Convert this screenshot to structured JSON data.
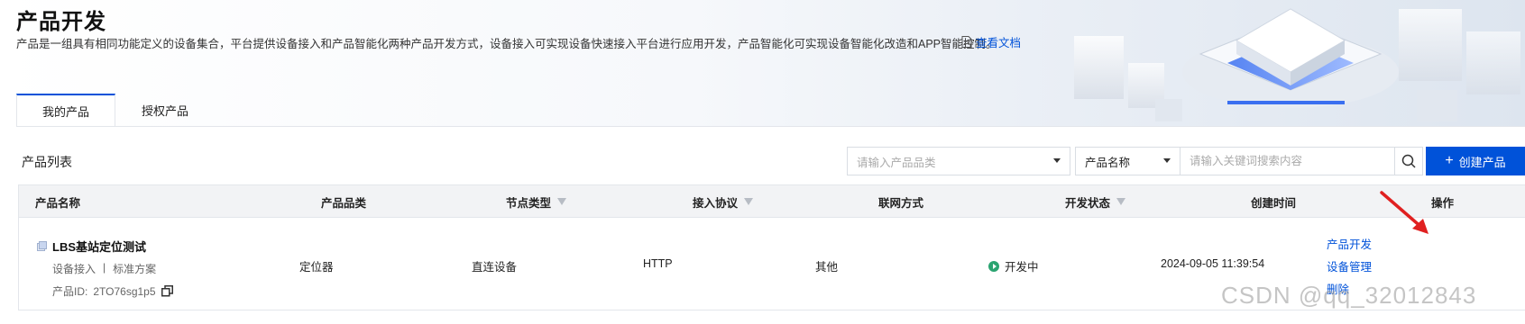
{
  "header": {
    "title": "产品开发",
    "description": "产品是一组具有相同功能定义的设备集合，平台提供设备接入和产品智能化两种产品开发方式，设备接入可实现设备快速接入平台进行应用开发，产品智能化可实现设备智能化改造和APP智能控制。",
    "doc_link": "查看文档"
  },
  "tabs": [
    {
      "label": "我的产品",
      "active": true
    },
    {
      "label": "授权产品",
      "active": false
    }
  ],
  "list": {
    "title": "产品列表",
    "category_select_placeholder": "请输入产品品类",
    "field_select_value": "产品名称",
    "search_placeholder": "请输入关键词搜索内容",
    "create_button": "创建产品"
  },
  "table": {
    "columns": [
      "产品名称",
      "产品品类",
      "节点类型",
      "接入协议",
      "联网方式",
      "开发状态",
      "创建时间",
      "操作"
    ],
    "rows": [
      {
        "name": "LBS基站定位测试",
        "access": "设备接入",
        "divider": "|",
        "scheme": "标准方案",
        "id_label": "产品ID:",
        "id": "2TO76sg1p5",
        "category": "定位器",
        "node_type": "直连设备",
        "protocol": "HTTP",
        "network": "其他",
        "status": "开发中",
        "created": "2024-09-05 11:39:54",
        "actions": [
          "产品开发",
          "设备管理",
          "删除"
        ]
      }
    ]
  },
  "watermark": "CSDN @qq_32012843",
  "colors": {
    "accent": "#0052d9",
    "status_green": "#2ba471",
    "arrow_red": "#e02020"
  }
}
